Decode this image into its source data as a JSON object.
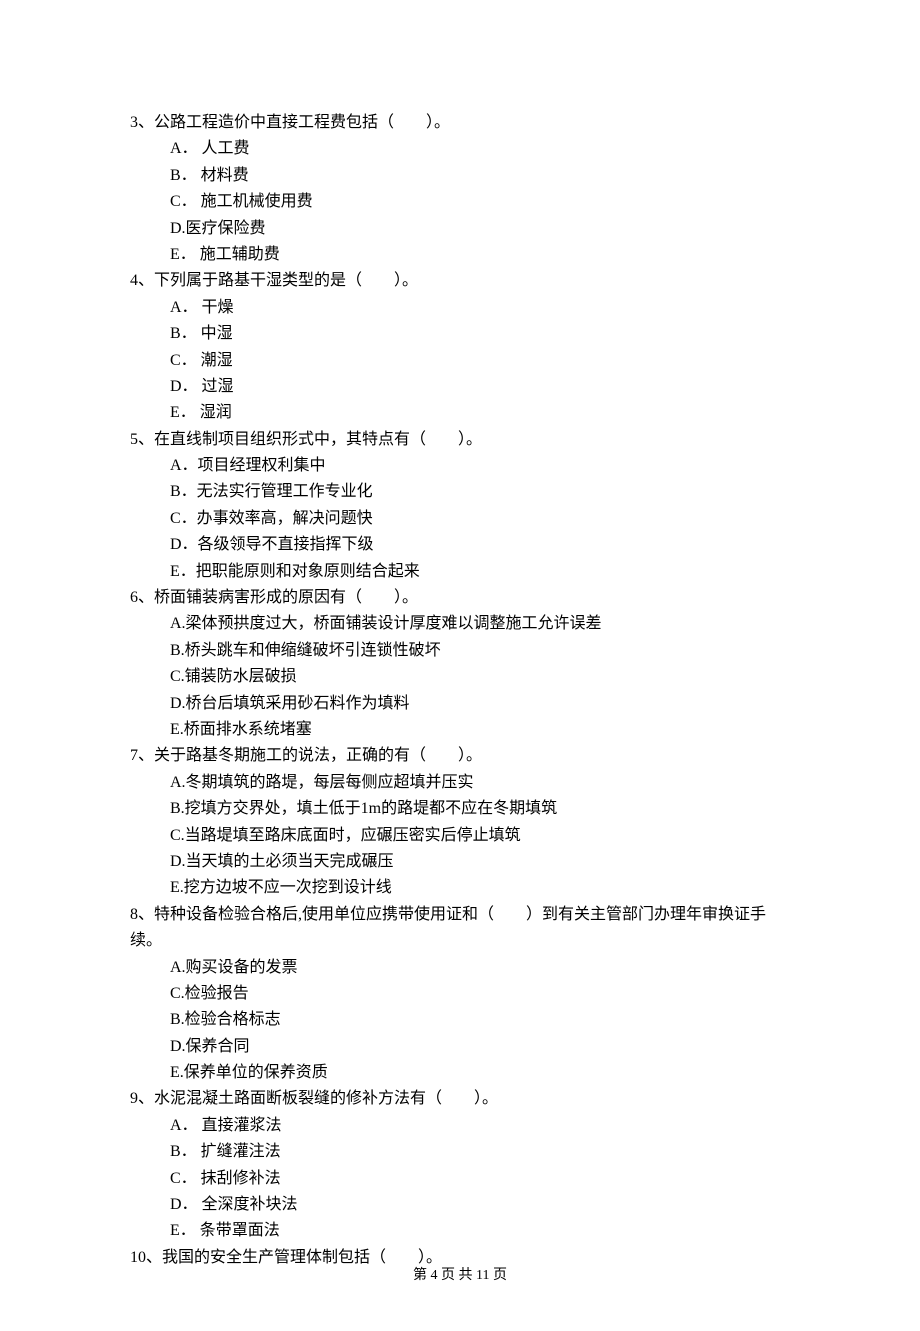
{
  "questions": [
    {
      "num": "3",
      "stem": "公路工程造价中直接工程费包括（　　）。",
      "options": [
        "A． 人工费",
        "B． 材料费",
        "C． 施工机械使用费",
        "D.医疗保险费",
        "E． 施工辅助费"
      ]
    },
    {
      "num": "4",
      "stem": "下列属于路基干湿类型的是（　　）。",
      "options": [
        "A． 干燥",
        "B． 中湿",
        "C． 潮湿",
        "D． 过湿",
        "E． 湿润"
      ]
    },
    {
      "num": "5",
      "stem": "在直线制项目组织形式中，其特点有（　　）。",
      "options": [
        "A．项目经理权利集中",
        "B．无法实行管理工作专业化",
        "C．办事效率高，解决问题快",
        "D．各级领导不直接指挥下级",
        "E．把职能原则和对象原则结合起来"
      ]
    },
    {
      "num": "6",
      "stem": "桥面铺装病害形成的原因有（　　）。",
      "options": [
        "A.梁体预拱度过大，桥面铺装设计厚度难以调整施工允许误差",
        "B.桥头跳车和伸缩缝破坏引连锁性破坏",
        "C.铺装防水层破损",
        "D.桥台后填筑采用砂石料作为填料",
        "E.桥面排水系统堵塞"
      ]
    },
    {
      "num": "7",
      "stem": "关于路基冬期施工的说法，正确的有（　　）。",
      "options": [
        "A.冬期填筑的路堤，每层每侧应超填并压实",
        "B.挖填方交界处，填土低于1m的路堤都不应在冬期填筑",
        "C.当路堤填至路床底面时，应碾压密实后停止填筑",
        "D.当天填的土必须当天完成碾压",
        "E.挖方边坡不应一次挖到设计线"
      ]
    },
    {
      "num": "8",
      "stem": "特种设备检验合格后,使用单位应携带使用证和（　　）到有关主管部门办理年审换证手",
      "stem2": "续。",
      "options": [
        "A.购买设备的发票",
        "C.检验报告",
        "B.检验合格标志",
        "D.保养合同",
        "E.保养单位的保养资质"
      ]
    },
    {
      "num": "9",
      "stem": "水泥混凝土路面断板裂缝的修补方法有（　　）。",
      "options": [
        "A． 直接灌浆法",
        "B． 扩缝灌注法",
        "C． 抹刮修补法",
        "D． 全深度补块法",
        "E． 条带罩面法"
      ]
    },
    {
      "num": "10",
      "stem": "我国的安全生产管理体制包括（　　）。",
      "options": []
    }
  ],
  "footer": "第 4 页 共 11 页"
}
